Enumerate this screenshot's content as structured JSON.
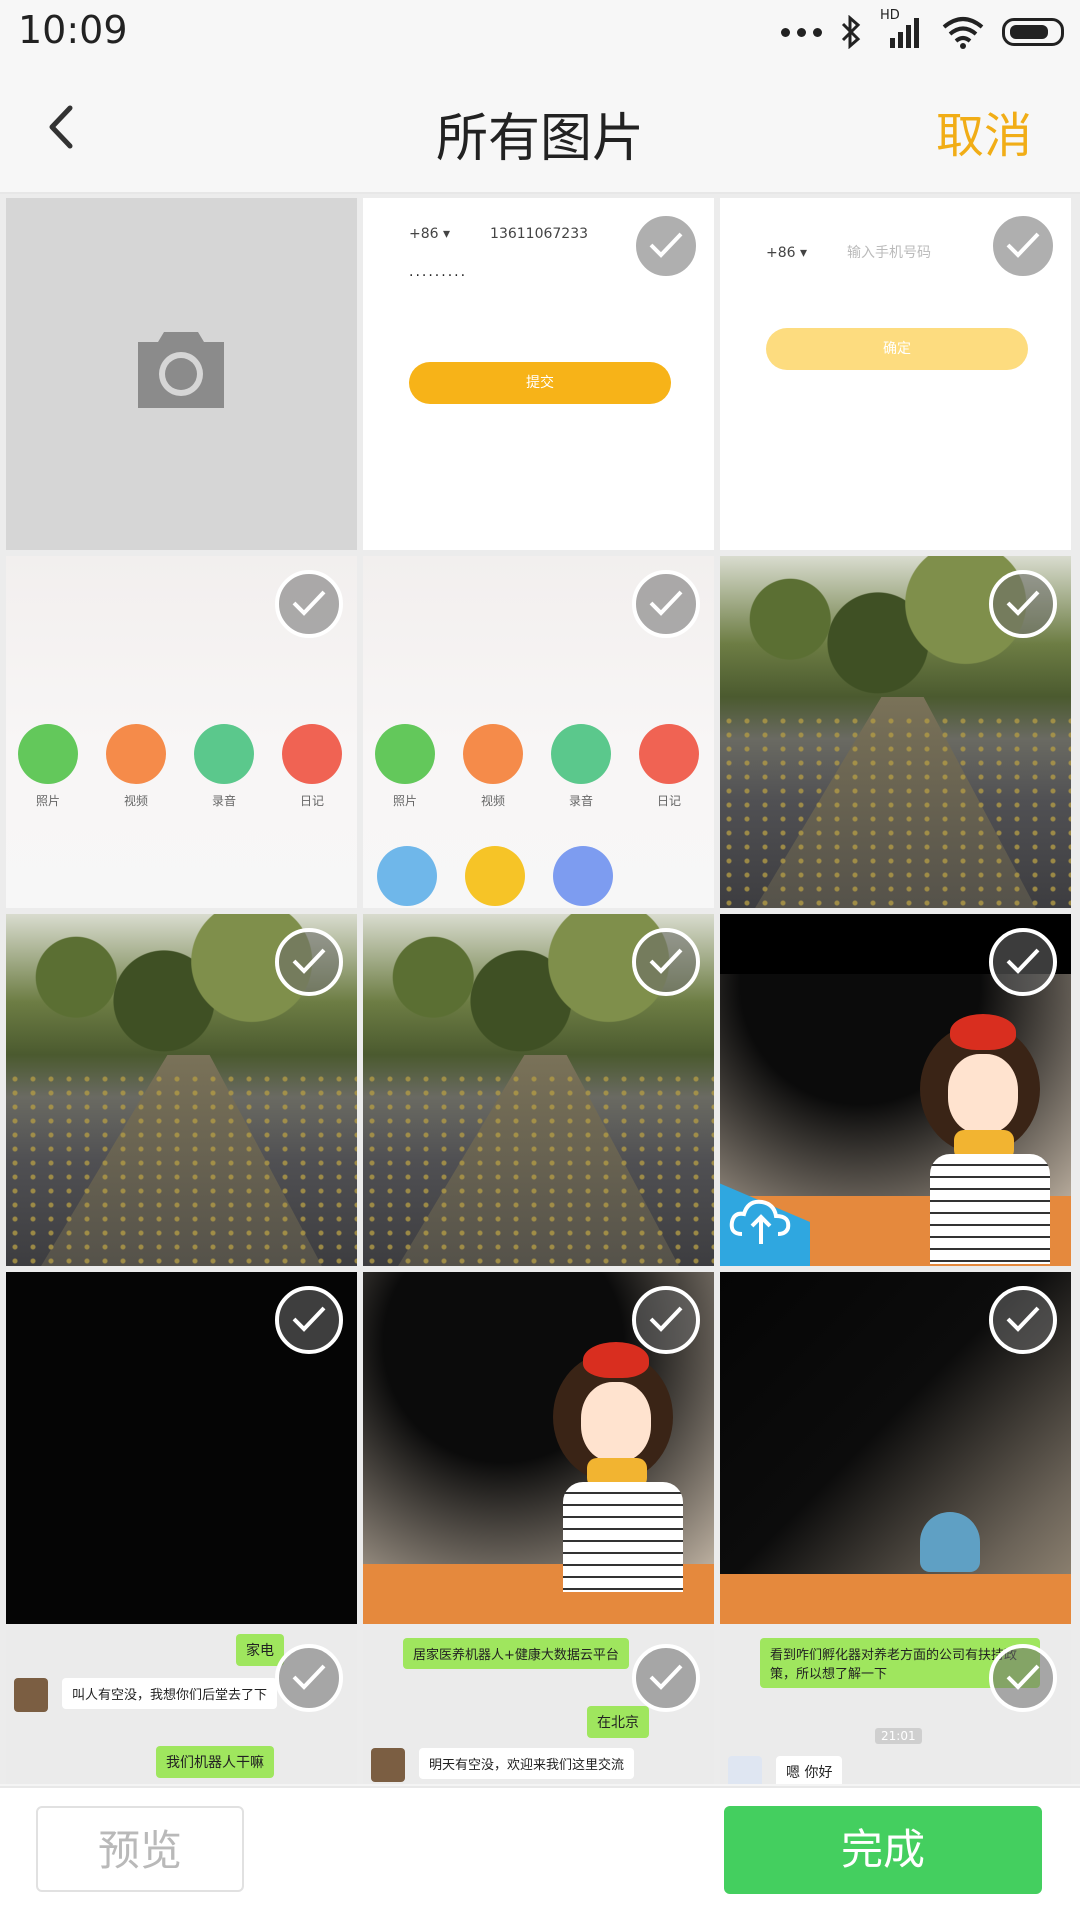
{
  "status_bar": {
    "time": "10:09",
    "network": "HD"
  },
  "header": {
    "title": "所有图片",
    "cancel_label": "取消"
  },
  "grid": {
    "cells": [
      {
        "kind": "camera",
        "icon": "camera-icon"
      },
      {
        "kind": "login-screenshot",
        "country_code": "+86 ▾",
        "phone": "13611067233",
        "password": "·········",
        "button": "提交"
      },
      {
        "kind": "login-screenshot",
        "country_code": "+86 ▾",
        "placeholder": "输入手机号码",
        "button": "确定"
      },
      {
        "kind": "menu-screenshot",
        "labels": [
          "照片",
          "视频",
          "录音",
          "日记"
        ]
      },
      {
        "kind": "menu-screenshot",
        "labels": [
          "照片",
          "视频",
          "录音",
          "日记"
        ]
      },
      {
        "kind": "photo-road"
      },
      {
        "kind": "photo-road"
      },
      {
        "kind": "photo-road"
      },
      {
        "kind": "illustration"
      },
      {
        "kind": "dark"
      },
      {
        "kind": "illustration"
      },
      {
        "kind": "illustration-dark"
      },
      {
        "kind": "chat-screenshot",
        "messages": [
          "家电",
          "叫人有空没，我想你们后堂去了下",
          "我们机器人干嘛"
        ]
      },
      {
        "kind": "chat-screenshot",
        "messages": [
          "居家医养机器人+健康大数据云平台",
          "在北京",
          "明天有空没，欢迎来我们这里交流"
        ]
      },
      {
        "kind": "chat-screenshot",
        "messages": [
          "看到咋们孵化器对养老方面的公司有扶持政策，所以想了解一下",
          "21:01",
          "嗯 你好"
        ]
      }
    ]
  },
  "bottom_bar": {
    "preview_label": "预览",
    "done_label": "完成"
  },
  "colors": {
    "accent_orange": "#f1ad16",
    "done_green": "#44cf5f",
    "login_button": "#f7b318"
  }
}
